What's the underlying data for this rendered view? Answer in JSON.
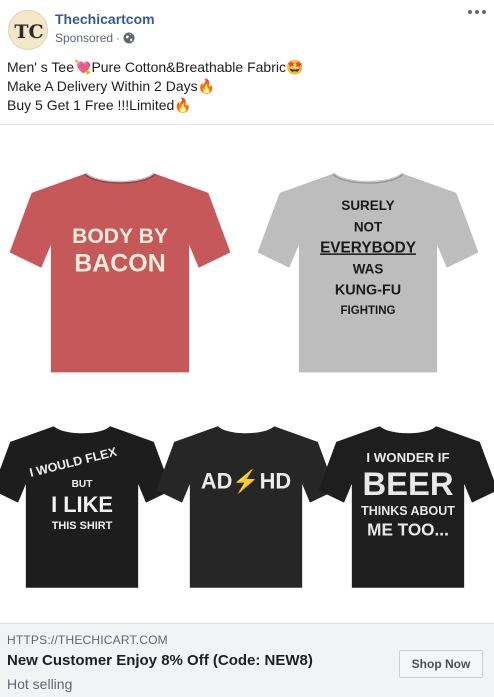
{
  "post": {
    "page_name": "Thechicartcom",
    "avatar_initials": "TC",
    "sponsored": "Sponsored",
    "sponsored_sep": "·",
    "caption_lines": [
      "Men' s Tee💘Pure Cotton&Breathable Fabric🤩",
      "Make A Delivery Within 2 Days🔥",
      "Buy 5 Get 1 Free !!!Limited🔥"
    ]
  },
  "products": [
    {
      "color": "#c6585a",
      "lines": [
        "BODY BY",
        "BACON"
      ],
      "text_color": "#f5ecd9"
    },
    {
      "color": "#bdbdbd",
      "lines": [
        "SURELY",
        "NOT",
        "EVERYBODY",
        "WAS",
        "KUNG-FU",
        "FIGHTING"
      ],
      "text_color": "#1a1a1a"
    },
    {
      "color": "#1d1d1d",
      "lines": [
        "I WOULD FLEX",
        "BUT",
        "I LIKE",
        "THIS SHIRT"
      ],
      "text_color": "#f2f2f2"
    },
    {
      "color": "#262626",
      "lines": [
        "AD⚡HD"
      ],
      "text_color": "#ededed"
    },
    {
      "color": "#1e1e1e",
      "lines": [
        "I WONDER IF",
        "BEER",
        "THINKS ABOUT",
        "ME TOO..."
      ],
      "text_color": "#e9e9e9"
    }
  ],
  "footer": {
    "url": "HTTPS://THECHICART.COM",
    "headline": "New Customer Enjoy 8% Off (Code: NEW8)",
    "sub": "Hot selling",
    "cta": "Shop Now"
  }
}
